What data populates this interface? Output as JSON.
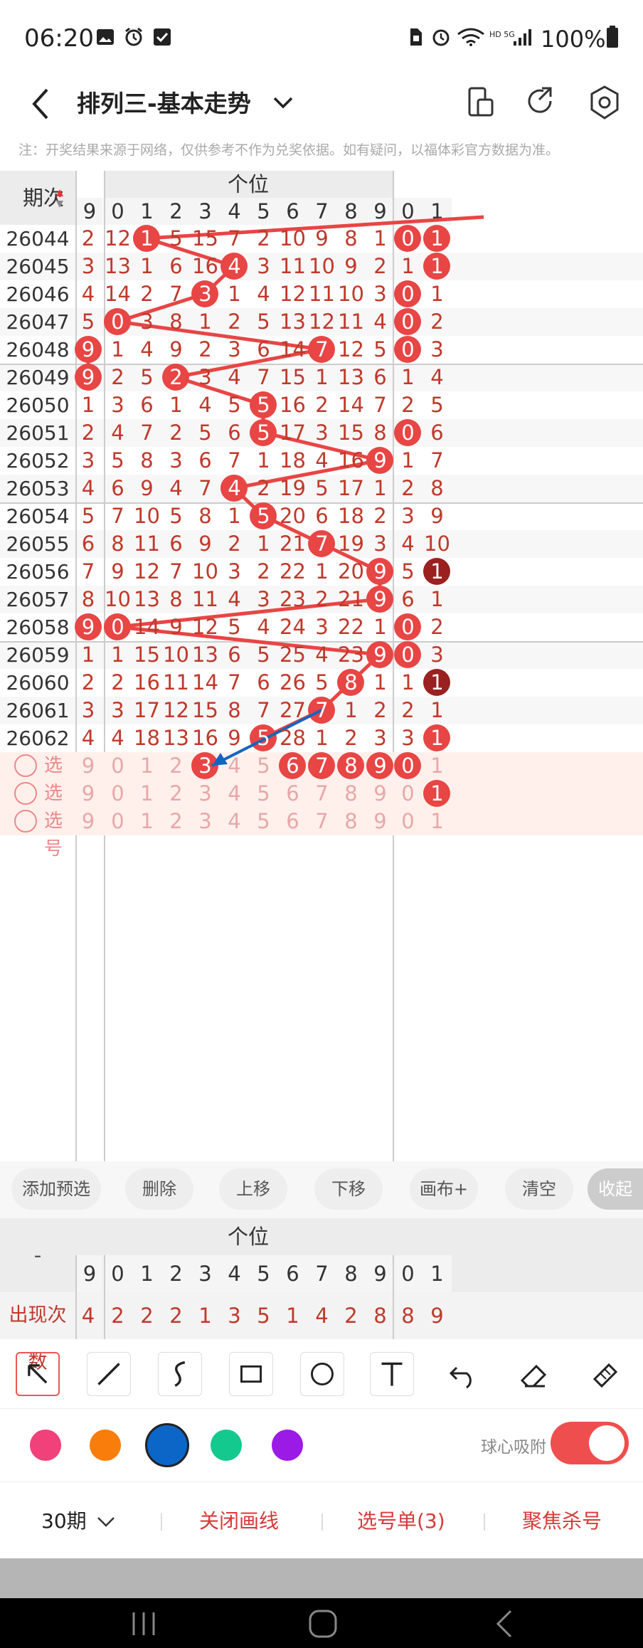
{
  "status": {
    "time": "06:20",
    "battery": "100%"
  },
  "appbar": {
    "title": "排列三-基本走势"
  },
  "notice": "注：开奖结果来源于网络，仅供参考不作为兑奖依据。如有疑问，以福体彩官方数据为准。",
  "grid": {
    "period_header": "期次",
    "group_header": "个位",
    "prev_col": "9",
    "digit_cols": [
      "0",
      "1",
      "2",
      "3",
      "4",
      "5",
      "6",
      "7",
      "8",
      "9"
    ],
    "next_cols": [
      "0",
      "1"
    ],
    "rows": [
      {
        "p": "26044",
        "prev": "2",
        "v": [
          "12",
          "1",
          "5",
          "15",
          "7",
          "2",
          "10",
          "9",
          "8",
          "1"
        ],
        "next": [
          "0",
          "1"
        ],
        "hit": 1,
        "prevHit": false,
        "nextHit": [
          true,
          true
        ]
      },
      {
        "p": "26045",
        "prev": "3",
        "v": [
          "13",
          "1",
          "6",
          "16",
          "4",
          "3",
          "11",
          "10",
          "9",
          "2"
        ],
        "next": [
          "1",
          "1"
        ],
        "hit": 4,
        "prevHit": false,
        "nextHit": [
          false,
          true
        ]
      },
      {
        "p": "26046",
        "prev": "4",
        "v": [
          "14",
          "2",
          "7",
          "3",
          "1",
          "4",
          "12",
          "11",
          "10",
          "3"
        ],
        "next": [
          "0",
          "1"
        ],
        "hit": 3,
        "prevHit": false,
        "nextHit": [
          true,
          false
        ]
      },
      {
        "p": "26047",
        "prev": "5",
        "v": [
          "0",
          "3",
          "8",
          "1",
          "2",
          "5",
          "13",
          "12",
          "11",
          "4"
        ],
        "next": [
          "0",
          "2"
        ],
        "hit": 0,
        "prevHit": false,
        "nextHit": [
          true,
          false
        ]
      },
      {
        "p": "26048",
        "prev": "9",
        "v": [
          "1",
          "4",
          "9",
          "2",
          "3",
          "6",
          "14",
          "7",
          "12",
          "5"
        ],
        "next": [
          "0",
          "3"
        ],
        "hit": 7,
        "prevHit": true,
        "nextHit": [
          true,
          false
        ]
      },
      {
        "p": "26049",
        "prev": "9",
        "v": [
          "2",
          "5",
          "2",
          "3",
          "4",
          "7",
          "15",
          "1",
          "13",
          "6"
        ],
        "next": [
          "1",
          "4"
        ],
        "hit": 2,
        "prevHit": true,
        "nextHit": [
          false,
          false
        ]
      },
      {
        "p": "26050",
        "prev": "1",
        "v": [
          "3",
          "6",
          "1",
          "4",
          "5",
          "5",
          "16",
          "2",
          "14",
          "7"
        ],
        "next": [
          "2",
          "5"
        ],
        "hit": 5,
        "prevHit": false,
        "nextHit": [
          false,
          false
        ]
      },
      {
        "p": "26051",
        "prev": "2",
        "v": [
          "4",
          "7",
          "2",
          "5",
          "6",
          "5",
          "17",
          "3",
          "15",
          "8"
        ],
        "next": [
          "0",
          "6"
        ],
        "hit": 5,
        "prevHit": false,
        "nextHit": [
          true,
          false
        ]
      },
      {
        "p": "26052",
        "prev": "3",
        "v": [
          "5",
          "8",
          "3",
          "6",
          "7",
          "1",
          "18",
          "4",
          "16",
          "9"
        ],
        "next": [
          "1",
          "7"
        ],
        "hit": 9,
        "prevHit": false,
        "nextHit": [
          false,
          false
        ]
      },
      {
        "p": "26053",
        "prev": "4",
        "v": [
          "6",
          "9",
          "4",
          "7",
          "4",
          "2",
          "19",
          "5",
          "17",
          "1"
        ],
        "next": [
          "2",
          "8"
        ],
        "hit": 4,
        "prevHit": false,
        "nextHit": [
          false,
          false
        ]
      },
      {
        "p": "26054",
        "prev": "5",
        "v": [
          "7",
          "10",
          "5",
          "8",
          "1",
          "5",
          "20",
          "6",
          "18",
          "2"
        ],
        "next": [
          "3",
          "9"
        ],
        "hit": 5,
        "prevHit": false,
        "nextHit": [
          false,
          false
        ]
      },
      {
        "p": "26055",
        "prev": "6",
        "v": [
          "8",
          "11",
          "6",
          "9",
          "2",
          "1",
          "21",
          "7",
          "19",
          "3"
        ],
        "next": [
          "4",
          "10"
        ],
        "hit": 7,
        "prevHit": false,
        "nextHit": [
          false,
          false
        ]
      },
      {
        "p": "26056",
        "prev": "7",
        "v": [
          "9",
          "12",
          "7",
          "10",
          "3",
          "2",
          "22",
          "1",
          "20",
          "9"
        ],
        "next": [
          "5",
          "1"
        ],
        "hit": 9,
        "prevHit": false,
        "nextHit": [
          false,
          true
        ]
      },
      {
        "p": "26057",
        "prev": "8",
        "v": [
          "10",
          "13",
          "8",
          "11",
          "4",
          "3",
          "23",
          "2",
          "21",
          "9"
        ],
        "next": [
          "6",
          "1"
        ],
        "hit": 9,
        "prevHit": false,
        "nextHit": [
          false,
          false
        ]
      },
      {
        "p": "26058",
        "prev": "9",
        "v": [
          "0",
          "14",
          "9",
          "12",
          "5",
          "4",
          "24",
          "3",
          "22",
          "1"
        ],
        "next": [
          "0",
          "2"
        ],
        "hit": 0,
        "prevHit": true,
        "nextHit": [
          true,
          false
        ]
      },
      {
        "p": "26059",
        "prev": "1",
        "v": [
          "1",
          "15",
          "10",
          "13",
          "6",
          "5",
          "25",
          "4",
          "23",
          "9"
        ],
        "next": [
          "0",
          "3"
        ],
        "hit": 9,
        "prevHit": false,
        "nextHit": [
          true,
          false
        ]
      },
      {
        "p": "26060",
        "prev": "2",
        "v": [
          "2",
          "16",
          "11",
          "14",
          "7",
          "6",
          "26",
          "5",
          "8",
          "1"
        ],
        "next": [
          "1",
          "1"
        ],
        "hit": 8,
        "prevHit": false,
        "nextHit": [
          false,
          true
        ]
      },
      {
        "p": "26061",
        "prev": "3",
        "v": [
          "3",
          "17",
          "12",
          "15",
          "8",
          "7",
          "27",
          "7",
          "1",
          "2"
        ],
        "next": [
          "2",
          "1"
        ],
        "hit": 7,
        "prevHit": false,
        "nextHit": [
          false,
          false
        ]
      },
      {
        "p": "26062",
        "prev": "4",
        "v": [
          "4",
          "18",
          "13",
          "16",
          "9",
          "5",
          "28",
          "1",
          "2",
          "3"
        ],
        "next": [
          "3",
          "1"
        ],
        "hit": 5,
        "prevHit": false,
        "nextHit": [
          false,
          true
        ]
      }
    ],
    "select_label": "选号",
    "select_rows": [
      {
        "prev": "9",
        "v": [
          "0",
          "1",
          "2",
          "3",
          "4",
          "5",
          "6",
          "7",
          "8",
          "9"
        ],
        "next": [
          "0",
          "1"
        ],
        "sel": [
          3,
          6,
          7,
          8,
          9
        ],
        "nextSel": [
          true,
          false
        ]
      },
      {
        "prev": "9",
        "v": [
          "0",
          "1",
          "2",
          "3",
          "4",
          "5",
          "6",
          "7",
          "8",
          "9"
        ],
        "next": [
          "0",
          "1"
        ],
        "sel": [],
        "nextSel": [
          false,
          true
        ]
      },
      {
        "prev": "9",
        "v": [
          "0",
          "1",
          "2",
          "3",
          "4",
          "5",
          "6",
          "7",
          "8",
          "9"
        ],
        "next": [
          "0",
          "1"
        ],
        "sel": [],
        "nextSel": [
          false,
          false
        ]
      }
    ]
  },
  "toolbar": {
    "buttons": [
      "添加预选",
      "删除",
      "上移",
      "下移",
      "画布+",
      "清空"
    ],
    "collapse": "收起"
  },
  "stats": {
    "dash": "-",
    "group_header": "个位",
    "count_label": "出现次数",
    "prev": "4",
    "counts": [
      "2",
      "2",
      "2",
      "1",
      "3",
      "5",
      "1",
      "4",
      "2",
      "8"
    ],
    "next": [
      "8",
      "9"
    ]
  },
  "drawtools": {
    "names": [
      "select-tool-icon",
      "line-tool-icon",
      "curve-tool-icon",
      "rect-tool-icon",
      "circle-tool-icon",
      "text-tool-icon",
      "undo-icon",
      "eraser-icon",
      "clear-icon"
    ]
  },
  "palette": {
    "colors": [
      "#f0417a",
      "#f97d0b",
      "#0b66c8",
      "#14c98d",
      "#9b1ae6"
    ],
    "selected": 2,
    "snap_label": "球心吸附",
    "accent": "#ef4e4e"
  },
  "bottom": {
    "periods": "30期",
    "close_draw": "关闭画线",
    "select_list": "选号单(3)",
    "focus": "聚焦杀号"
  }
}
